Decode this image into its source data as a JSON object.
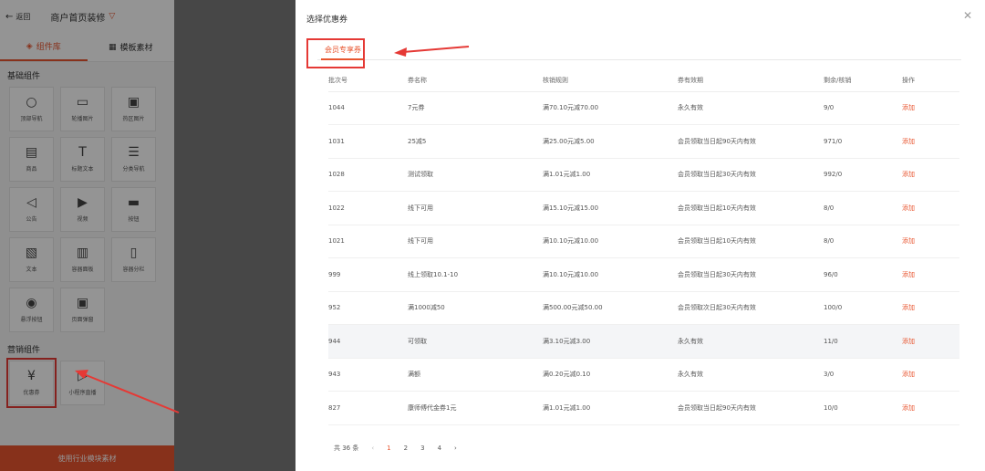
{
  "topbar": {
    "back_label": "返回",
    "page_name": "商户首页装修"
  },
  "tabs": [
    {
      "label": "组件库",
      "active": true
    },
    {
      "label": "模板素材",
      "active": false
    }
  ],
  "basic": {
    "title": "基础组件",
    "items": [
      {
        "label": "顶部导航",
        "icon": "search-icon"
      },
      {
        "label": "轮播图片",
        "icon": "image-icon"
      },
      {
        "label": "热区图片",
        "icon": "hotzone-icon"
      },
      {
        "label": "商品",
        "icon": "product-icon"
      },
      {
        "label": "标题文本",
        "icon": "text-t-icon"
      },
      {
        "label": "分类导航",
        "icon": "list-icon"
      },
      {
        "label": "公告",
        "icon": "speaker-icon"
      },
      {
        "label": "视频",
        "icon": "play-icon"
      },
      {
        "label": "按钮",
        "icon": "button-icon"
      },
      {
        "label": "文本",
        "icon": "richtext-icon"
      },
      {
        "label": "容器面板",
        "icon": "container-icon"
      },
      {
        "label": "容器分栏",
        "icon": "column-icon"
      },
      {
        "label": "悬浮按钮",
        "icon": "float-button-icon"
      },
      {
        "label": "页面弹窗",
        "icon": "popup-icon"
      }
    ]
  },
  "marketing": {
    "title": "营销组件",
    "items": [
      {
        "label": "优惠券",
        "icon": "coupon-icon"
      },
      {
        "label": "小程序直播",
        "icon": "live-icon"
      }
    ]
  },
  "bottom_button": "使用行业模块素材",
  "modal": {
    "title": "选择优惠券",
    "tab": "会员专享券",
    "columns": [
      "批次号",
      "券名称",
      "核销规则",
      "券有效期",
      "剩余/核销",
      "操作"
    ],
    "rows": [
      [
        "1044",
        "7元券",
        "满70.10元减70.00",
        "永久有效",
        "9/0",
        "添加"
      ],
      [
        "1031",
        "25减5",
        "满25.00元减5.00",
        "会员领取当日起90天内有效",
        "971/0",
        "添加"
      ],
      [
        "1028",
        "测试领取",
        "满1.01元减1.00",
        "会员领取当日起30天内有效",
        "992/0",
        "添加"
      ],
      [
        "1022",
        "线下可用",
        "满15.10元减15.00",
        "会员领取当日起10天内有效",
        "8/0",
        "添加"
      ],
      [
        "1021",
        "线下可用",
        "满10.10元减10.00",
        "会员领取当日起10天内有效",
        "8/0",
        "添加"
      ],
      [
        "999",
        "线上领取10.1-10",
        "满10.10元减10.00",
        "会员领取当日起30天内有效",
        "96/0",
        "添加"
      ],
      [
        "952",
        "满1000减50",
        "满500.00元减50.00",
        "会员领取次日起30天内有效",
        "100/0",
        "添加"
      ],
      [
        "944",
        "可领取",
        "满3.10元减3.00",
        "永久有效",
        "11/0",
        "添加"
      ],
      [
        "943",
        "满额",
        "满0.20元减0.10",
        "永久有效",
        "3/0",
        "添加"
      ],
      [
        "827",
        "康师傅代金券1元",
        "满1.01元减1.00",
        "会员领取当日起90天内有效",
        "10/0",
        "添加"
      ]
    ],
    "hover_row": 7,
    "pagination": {
      "total": "共 36 条",
      "pages": [
        "1",
        "2",
        "3",
        "4"
      ],
      "current": "1"
    }
  },
  "colors": {
    "accent": "#e8552f",
    "annotation": "#e53935"
  }
}
